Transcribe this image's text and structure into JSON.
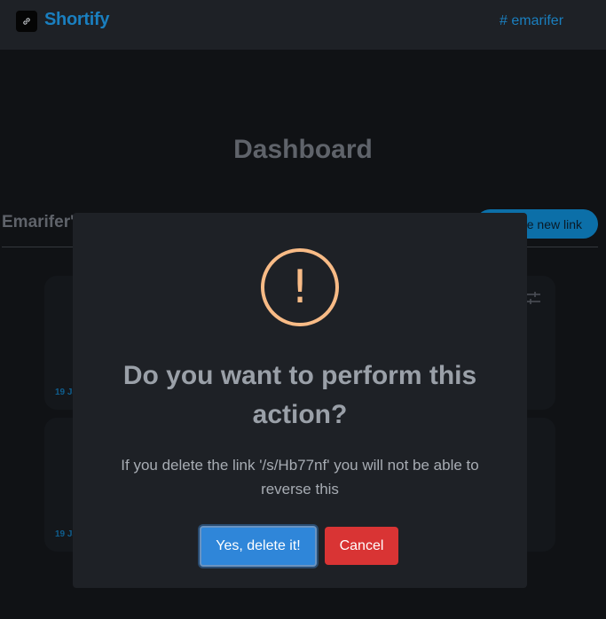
{
  "navbar": {
    "brand": "Shortify",
    "user_tag": "# emarifer",
    "logo_icon": "link-icon"
  },
  "page": {
    "title": "Dashboard",
    "section_title": "Emarifer's",
    "new_link_button": "e new link",
    "filter_icon": "sliders-icon"
  },
  "cards": [
    {
      "date": "19 Ja"
    },
    {
      "date": "19 Ja"
    }
  ],
  "modal": {
    "icon": "exclamation-icon",
    "icon_glyph": "!",
    "title": "Do you want to perform this action?",
    "text": "If you delete the link '/s/Hb77nf' you will not be able to reverse this",
    "confirm_label": "Yes, delete it!",
    "cancel_label": "Cancel"
  },
  "colors": {
    "accent": "#1a7fbf",
    "warning": "#f8bb86",
    "confirm": "#2f86d9",
    "cancel": "#d93434"
  }
}
